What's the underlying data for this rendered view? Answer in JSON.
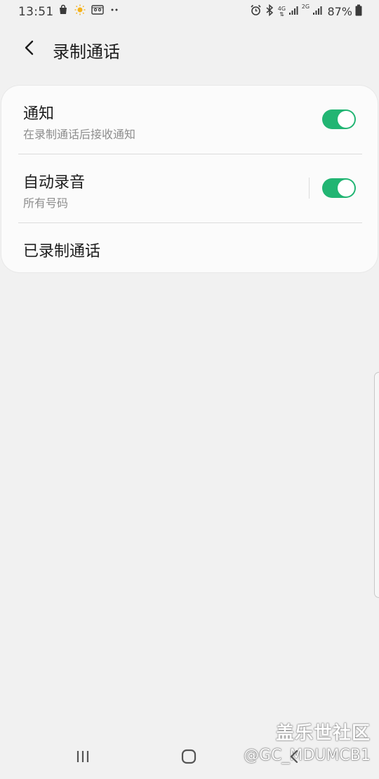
{
  "status_bar": {
    "time": "13:51",
    "network_4g": "4G",
    "network_2g": "2G",
    "battery": "87%",
    "left_icons": [
      "shopping-bag-icon",
      "weather-sun-icon",
      "cassette-icon",
      "more-dots-icon"
    ],
    "right_icons": [
      "alarm-icon",
      "bluetooth-icon",
      "signal-icon",
      "signal-icon",
      "battery-icon"
    ]
  },
  "header": {
    "back_icon": "back-arrow-icon",
    "title": "录制通话"
  },
  "settings": {
    "notification": {
      "title": "通知",
      "subtitle": "在录制通话后接收通知",
      "enabled": true
    },
    "auto_record": {
      "title": "自动录音",
      "subtitle": "所有号码",
      "enabled": true
    },
    "recorded_calls": {
      "title": "已录制通话"
    }
  },
  "colors": {
    "background": "#f1f1f1",
    "card": "#fbfbfb",
    "toggle_on": "#22b573"
  },
  "nav_bar": {
    "recent_icon": "recent-apps-icon",
    "home_icon": "home-icon",
    "back_icon": "nav-back-icon"
  },
  "watermark": {
    "title": "盖乐世社区",
    "handle": "@GC_MDUMCB1"
  }
}
